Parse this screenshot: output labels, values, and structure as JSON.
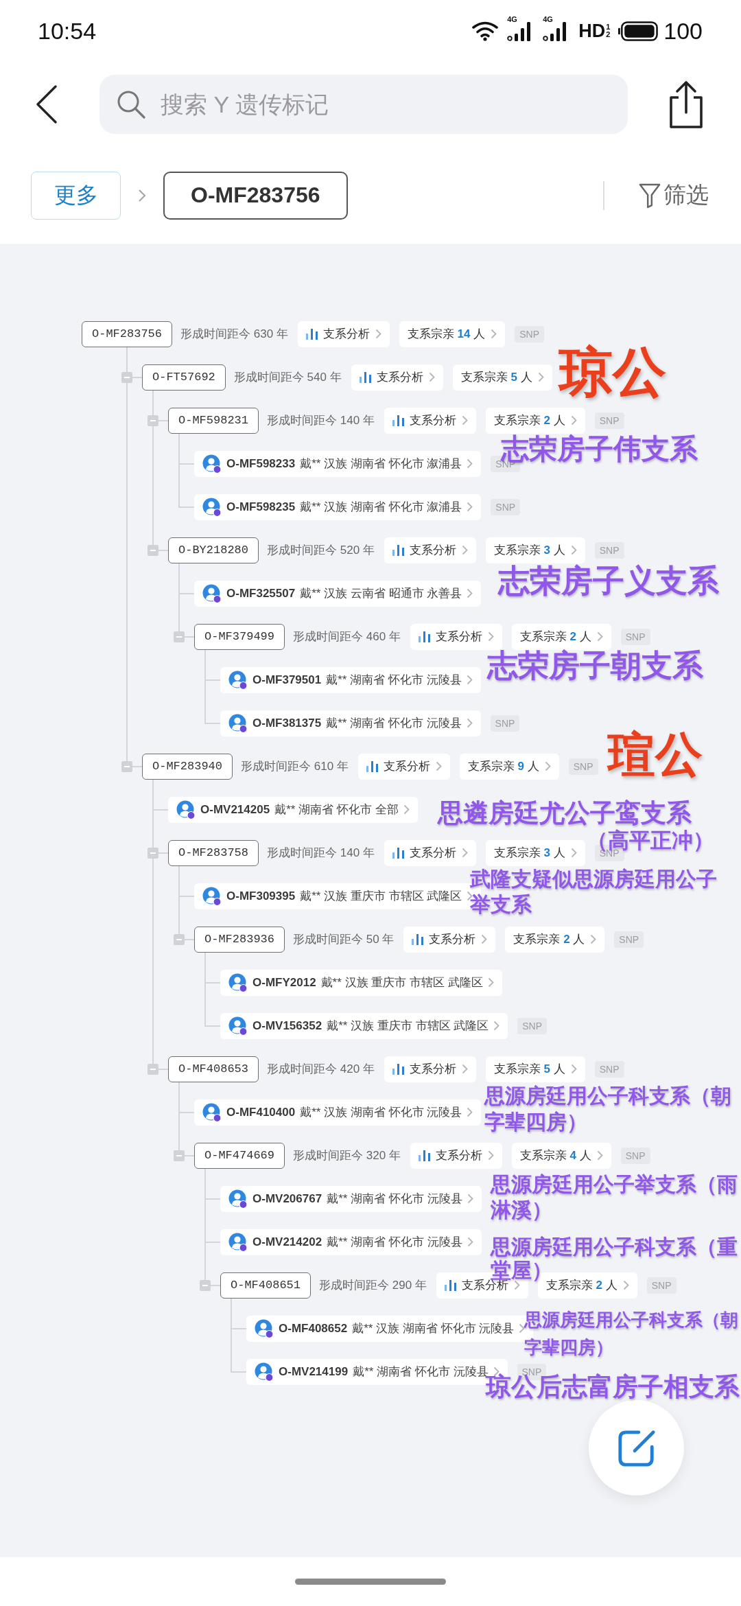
{
  "status_bar": {
    "time": "10:54",
    "networks": [
      {
        "label": "4G"
      },
      {
        "label": "4G"
      }
    ],
    "hd": "HD",
    "hd_marks": [
      "1",
      "2"
    ],
    "battery": "100"
  },
  "search": {
    "placeholder": "搜索 Y 遗传标记"
  },
  "breadcrumb": {
    "more": "更多",
    "current": "O-MF283756",
    "filter": "筛选"
  },
  "tree": {
    "kind": "branch",
    "id": "O-MF283756",
    "age": "形成时间距今 630 年",
    "analysis": "支系分析",
    "kin": "支系宗亲 **14** 人",
    "tag": "SNP",
    "children": [
      {
        "kind": "branch",
        "id": "O-FT57692",
        "age": "形成时间距今 540 年",
        "analysis": "支系分析",
        "kin": "支系宗亲 **5** 人",
        "expanded": true,
        "children": [
          {
            "kind": "branch",
            "id": "O-MF598231",
            "age": "形成时间距今 140 年",
            "analysis": "支系分析",
            "kin": "支系宗亲 **2** 人",
            "tag": "SNP",
            "expanded": true,
            "children": [
              {
                "kind": "sample",
                "id": "O-MF598233",
                "info": "戴** 汉族 湖南省 怀化市 溆浦县",
                "tag": "SNP"
              },
              {
                "kind": "sample",
                "id": "O-MF598235",
                "info": "戴** 汉族 湖南省 怀化市 溆浦县",
                "tag": "SNP"
              }
            ]
          },
          {
            "kind": "branch",
            "id": "O-BY218280",
            "age": "形成时间距今 520 年",
            "analysis": "支系分析",
            "kin": "支系宗亲 **3** 人",
            "tag": "SNP",
            "expanded": true,
            "children": [
              {
                "kind": "sample",
                "id": "O-MF325507",
                "info": "戴** 汉族 云南省 昭通市 永善县"
              },
              {
                "kind": "branch",
                "id": "O-MF379499",
                "age": "形成时间距今 460 年",
                "analysis": "支系分析",
                "kin": "支系宗亲 **2** 人",
                "tag": "SNP",
                "expanded": true,
                "children": [
                  {
                    "kind": "sample",
                    "id": "O-MF379501",
                    "info": "戴** 湖南省 怀化市 沅陵县"
                  },
                  {
                    "kind": "sample",
                    "id": "O-MF381375",
                    "info": "戴** 湖南省 怀化市 沅陵县",
                    "tag": "SNP"
                  }
                ]
              }
            ]
          }
        ]
      },
      {
        "kind": "branch",
        "id": "O-MF283940",
        "age": "形成时间距今 610 年",
        "analysis": "支系分析",
        "kin": "支系宗亲 **9** 人",
        "tag": "SNP",
        "expanded": true,
        "children": [
          {
            "kind": "sample",
            "id": "O-MV214205",
            "info": "戴** 湖南省 怀化市 全部"
          },
          {
            "kind": "branch",
            "id": "O-MF283758",
            "age": "形成时间距今 140 年",
            "analysis": "支系分析",
            "kin": "支系宗亲 **3** 人",
            "tag": "SNP",
            "expanded": true,
            "children": [
              {
                "kind": "sample",
                "id": "O-MF309395",
                "info": "戴** 汉族 重庆市 市辖区 武隆区"
              },
              {
                "kind": "branch",
                "id": "O-MF283936",
                "age": "形成时间距今 50 年",
                "analysis": "支系分析",
                "kin": "支系宗亲 **2** 人",
                "tag": "SNP",
                "expanded": true,
                "children": [
                  {
                    "kind": "sample",
                    "id": "O-MFY2012",
                    "info": "戴** 汉族 重庆市 市辖区 武隆区"
                  },
                  {
                    "kind": "sample",
                    "id": "O-MV156352",
                    "info": "戴** 汉族 重庆市 市辖区 武隆区",
                    "tag": "SNP"
                  }
                ]
              }
            ]
          },
          {
            "kind": "branch",
            "id": "O-MF408653",
            "age": "形成时间距今 420 年",
            "analysis": "支系分析",
            "kin": "支系宗亲 **5** 人",
            "tag": "SNP",
            "expanded": true,
            "children": [
              {
                "kind": "sample",
                "id": "O-MF410400",
                "info": "戴** 汉族 湖南省 怀化市 沅陵县"
              },
              {
                "kind": "branch",
                "id": "O-MF474669",
                "age": "形成时间距今 320 年",
                "analysis": "支系分析",
                "kin": "支系宗亲 **4** 人",
                "tag": "SNP",
                "expanded": true,
                "children": [
                  {
                    "kind": "sample",
                    "id": "O-MV206767",
                    "info": "戴** 湖南省 怀化市 沅陵县"
                  },
                  {
                    "kind": "sample",
                    "id": "O-MV214202",
                    "info": "戴** 湖南省 怀化市 沅陵县"
                  },
                  {
                    "kind": "branch",
                    "id": "O-MF408651",
                    "age": "形成时间距今 290 年",
                    "analysis": "支系分析",
                    "kin": "支系宗亲 **2** 人",
                    "tag": "SNP",
                    "expanded": true,
                    "children": [
                      {
                        "kind": "sample",
                        "id": "O-MF408652",
                        "info": "戴** 汉族 湖南省 怀化市 沅陵县"
                      },
                      {
                        "kind": "sample",
                        "id": "O-MV214199",
                        "info": "戴** 湖南省 怀化市 沅陵县",
                        "tag": "SNP"
                      }
                    ]
                  }
                ]
              }
            ]
          }
        ]
      }
    ]
  },
  "annotations": [
    {
      "kind": "title",
      "text": "琼公"
    },
    {
      "kind": "note",
      "text": "志荣房子伟支系"
    },
    {
      "kind": "note",
      "text": "志荣房子义支系"
    },
    {
      "kind": "note",
      "text": "志荣房子朝支系"
    },
    {
      "kind": "title",
      "text": "瑄公"
    },
    {
      "kind": "note",
      "text": "思遴房廷尤公子鸾支系"
    },
    {
      "kind": "note",
      "text": "（高平正冲）"
    },
    {
      "kind": "note",
      "text": "武隆支疑似思源房廷用公子举支系"
    },
    {
      "kind": "note",
      "text": "思源房廷用公子科支系（朝字辈四房）"
    },
    {
      "kind": "note",
      "text": "思源房廷用公子举支系（雨淋溪）"
    },
    {
      "kind": "note",
      "text": "思源房廷用公子科支系（重堂屋）"
    },
    {
      "kind": "note",
      "text": "思源房廷用公子科支系（朝字辈四房）"
    },
    {
      "kind": "note",
      "text": "琼公后志富房子相支系"
    }
  ]
}
